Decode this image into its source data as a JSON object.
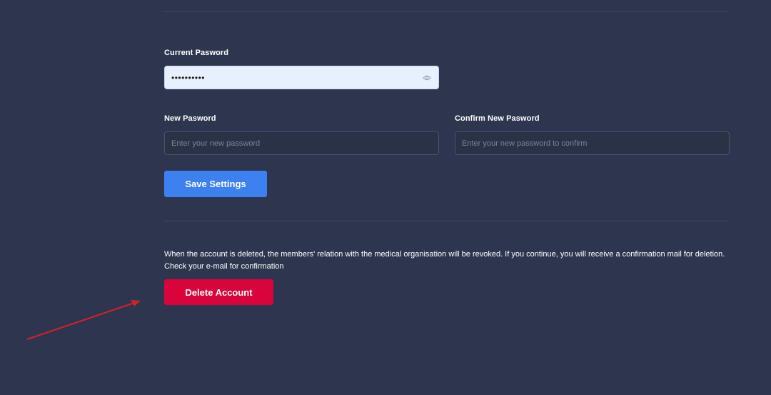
{
  "password_section": {
    "current_password": {
      "label": "Current Pasword",
      "value": "••••••••••"
    },
    "new_password": {
      "label": "New Pasword",
      "placeholder": "Enter your new password"
    },
    "confirm_password": {
      "label": "Confirm New Pasword",
      "placeholder": "Enter your new password to confirm"
    },
    "save_label": "Save Settings"
  },
  "delete_section": {
    "warning_line1": "When the account is deleted, the members' relation with the medical organisation will be revoked. If you continue, you will receive a confirmation mail for deletion.",
    "warning_line2": "Check your e-mail for confirmation",
    "delete_label": "Delete Account"
  },
  "colors": {
    "background": "#2e354e",
    "primary": "#3d80ef",
    "danger": "#d9043c",
    "annotation_arrow": "#d81e2a"
  },
  "icons": {
    "password_visibility": "eye-icon"
  }
}
